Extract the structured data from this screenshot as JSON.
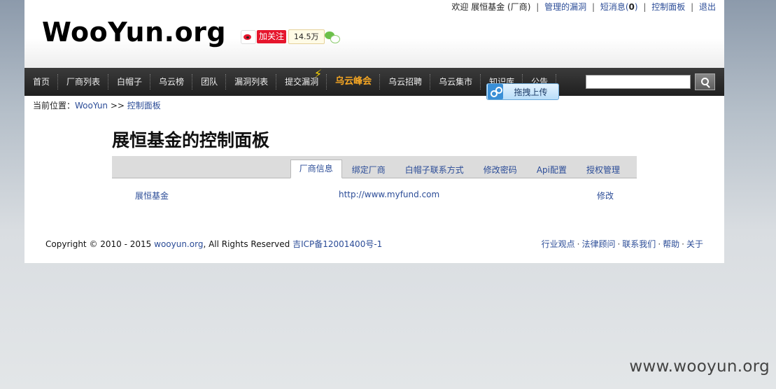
{
  "top_links": {
    "welcome": "欢迎",
    "user": "展恒基金 (厂商)",
    "manage_vulns": "管理的漏洞",
    "messages_prefix": "短消息(",
    "messages_count": "0",
    "messages_suffix": ")",
    "control_panel": "控制面板",
    "logout": "退出"
  },
  "header": {
    "logo": "WooYun.org",
    "weibo_follow": "加关注",
    "fans_count": "14.5万"
  },
  "nav": {
    "items": [
      "首页",
      "厂商列表",
      "白帽子",
      "乌云榜",
      "团队",
      "漏洞列表",
      "提交漏洞",
      "乌云峰会",
      "乌云招聘",
      "乌云集市",
      "知识库",
      "公告"
    ],
    "upload_label": "拖拽上传"
  },
  "breadcrumb": {
    "prefix": "当前位置：",
    "home": "WooYun",
    "sep": ">>",
    "current": "控制面板"
  },
  "main": {
    "title": "展恒基金的控制面板",
    "tabs": [
      "厂商信息",
      "绑定厂商",
      "白帽子联系方式",
      "修改密码",
      "Api配置",
      "授权管理"
    ],
    "active_tab": "厂商信息",
    "row": {
      "name": "展恒基金",
      "url": "http://www.myfund.com",
      "action": "修改"
    }
  },
  "footer": {
    "copyright_prefix": "Copyright © 2010 - 2015 ",
    "site_link": "wooyun.org",
    "rights": ", All Rights Reserved ",
    "icp": "吉ICP备12001400号-1",
    "links": [
      "行业观点",
      "法律顾问",
      "联系我们",
      "帮助",
      "关于"
    ]
  },
  "watermark": "www.wooyun.org",
  "colors": {
    "link": "#2b4c97",
    "nav_bg": "#2b2b2b",
    "hot_nav": "#f5a623",
    "weibo_red": "#e6162d"
  }
}
